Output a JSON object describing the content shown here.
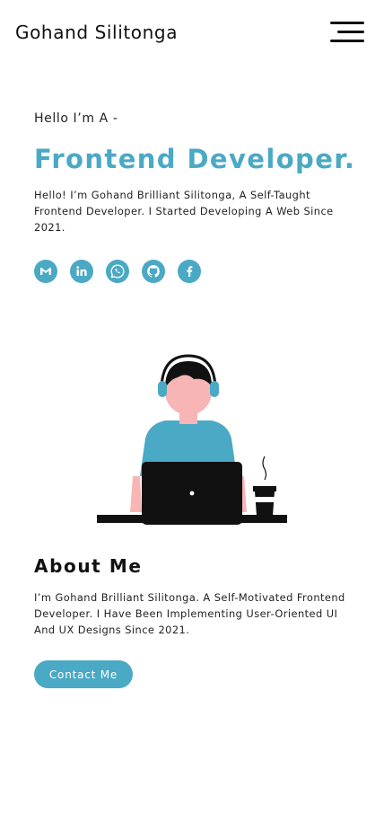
{
  "header": {
    "brand": "Gohand Silitonga",
    "menu_icon": "hamburger-menu-icon"
  },
  "hero": {
    "greeting": "Hello I’m A -",
    "role": "Frontend Developer.",
    "intro": "Hello! I’m Gohand Brilliant Silitonga, A Self-Taught Frontend Developer. I Started Developing A Web Since 2021."
  },
  "socials": [
    {
      "icon": "gmail-icon"
    },
    {
      "icon": "linkedin-icon"
    },
    {
      "icon": "whatsapp-icon"
    },
    {
      "icon": "github-icon"
    },
    {
      "icon": "facebook-icon"
    }
  ],
  "illustration": {
    "icon": "developer-at-laptop-illustration"
  },
  "about": {
    "title": "About Me",
    "text": "I’m Gohand Brilliant Silitonga. A Self-Motivated Frontend Developer. I Have Been Implementing User-Oriented UI And UX Designs Since 2021.",
    "button_label": "Contact Me"
  },
  "colors": {
    "accent": "#4aa9c4",
    "text": "#111111",
    "background": "#ffffff",
    "skin": "#f7b5b5"
  }
}
